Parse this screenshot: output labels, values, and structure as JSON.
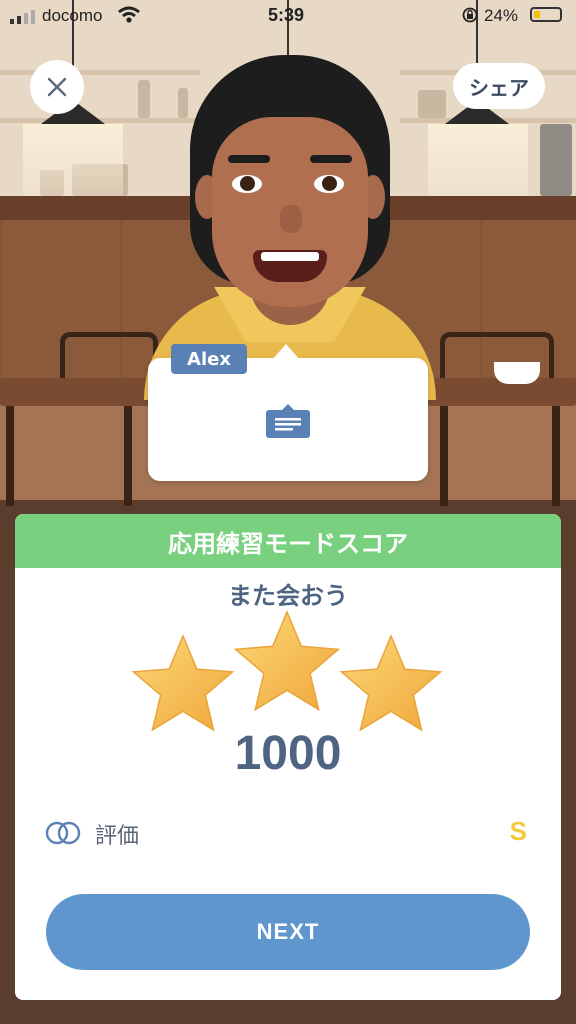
{
  "status_bar": {
    "carrier": "docomo",
    "time": "5:39",
    "battery_percent": "24%"
  },
  "top_bar": {
    "share_label": "シェア"
  },
  "speech_bubble": {
    "speaker": "Alex"
  },
  "score_card": {
    "title": "応用練習モードスコア",
    "subtitle": "また会おう",
    "stars_earned": 3,
    "stars_total": 3,
    "score": "1000",
    "rating_label": "評価",
    "rating_grade": "S",
    "next_label": "NEXT"
  },
  "colors": {
    "header_green": "#79d07f",
    "primary_blue": "#5f96cd",
    "text_navy": "#4f6483",
    "grade_gold": "#f0c93f",
    "star_gold": "#f5c24a"
  }
}
